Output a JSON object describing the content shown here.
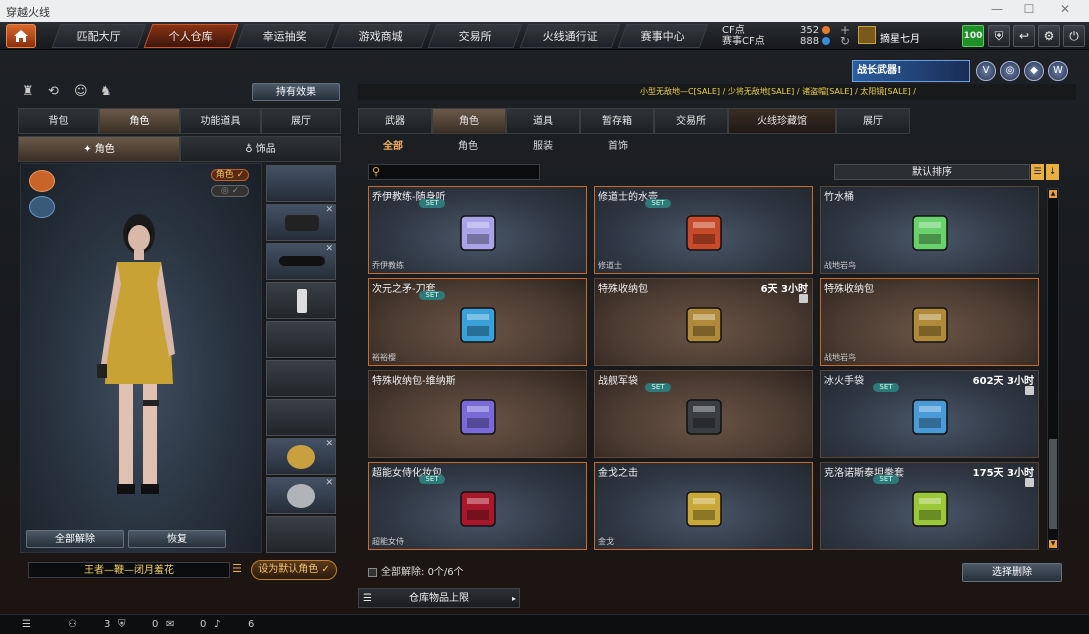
{
  "window": {
    "title": "穿越火线"
  },
  "nav": {
    "tabs": [
      "匹配大厅",
      "个人仓库",
      "幸运抽奖",
      "游戏商城",
      "交易所",
      "火线通行证",
      "赛事中心"
    ],
    "active": "个人仓库",
    "cf_label": "CF点",
    "cf_value": "352",
    "event_cf_label": "赛事CF点",
    "event_cf_value": "888",
    "username": "摘星七月",
    "level": "100"
  },
  "left": {
    "effect_button": "持有效果",
    "tabs": [
      "背包",
      "角色",
      "功能道具",
      "展厅"
    ],
    "active_tab": "角色",
    "subtabs": [
      "角色",
      "饰品"
    ],
    "role_toggle": "角色",
    "unequip_all": "全部解除",
    "restore": "恢复",
    "character_name": "王者—鞭—闭月羞花",
    "set_default": "设为默认角色"
  },
  "right": {
    "ticker": "小型无敌地—C[SALE] / 少将无敌地[SALE] / 诸盗帽[SALE] / 太阳镜[SALE] /",
    "banner": "战长武器!",
    "category_tabs": [
      "武器",
      "角色",
      "道具",
      "暂存箱",
      "交易所",
      "火线珍藏馆",
      "展厅"
    ],
    "active_category": "角色",
    "sub_tabs": [
      "全部",
      "角色",
      "服装",
      "首饰"
    ],
    "active_sub": "全部",
    "sort_label": "默认排序",
    "items": [
      {
        "name": "乔伊教练-随身听",
        "set": "SET",
        "tag": "乔伊教练",
        "duration": "",
        "color": "#a9a4e8"
      },
      {
        "name": "修道士的水壶",
        "set": "SET",
        "tag": "修道士",
        "duration": "",
        "color": "#c84a2a"
      },
      {
        "name": "竹水桶",
        "set": "",
        "tag": "战地岩鸟",
        "duration": "",
        "color": "#6ad26a"
      },
      {
        "name": "次元之矛-刀套",
        "set": "SET",
        "tag": "裕裕樱",
        "duration": "",
        "color": "#3aa0d8"
      },
      {
        "name": "特殊收纳包",
        "set": "",
        "tag": "",
        "duration": "6天 3小时",
        "color": "#b08a3a"
      },
      {
        "name": "特殊收纳包",
        "set": "",
        "tag": "战地岩鸟",
        "duration": "",
        "color": "#b08a3a"
      },
      {
        "name": "特殊收纳包-维纳斯",
        "set": "",
        "tag": "",
        "duration": "",
        "color": "#7a6ad8"
      },
      {
        "name": "战舰军袋",
        "set": "SET",
        "tag": "",
        "duration": "",
        "color": "#3a3d42"
      },
      {
        "name": "冰火手袋",
        "set": "SET",
        "tag": "",
        "duration": "602天 3小时",
        "color": "#4a9ad8"
      },
      {
        "name": "超能女侍化妆包",
        "set": "SET",
        "tag": "超能女侍",
        "duration": "",
        "color": "#a8182a"
      },
      {
        "name": "金戈之击",
        "set": "",
        "tag": "金戈",
        "duration": "",
        "color": "#c8a838"
      },
      {
        "name": "克洛诺斯泰坦拳套",
        "set": "SET",
        "tag": "",
        "duration": "175天 3小时",
        "color": "#9ac838"
      }
    ],
    "unequip_all_label": "全部解除:",
    "unequip_count": "0个/6个",
    "select_delete": "选择删除",
    "capacity_label": "仓库物品上限"
  },
  "bottom": {
    "v1": "3",
    "v2": "0",
    "v3": "0",
    "v4": "6"
  }
}
